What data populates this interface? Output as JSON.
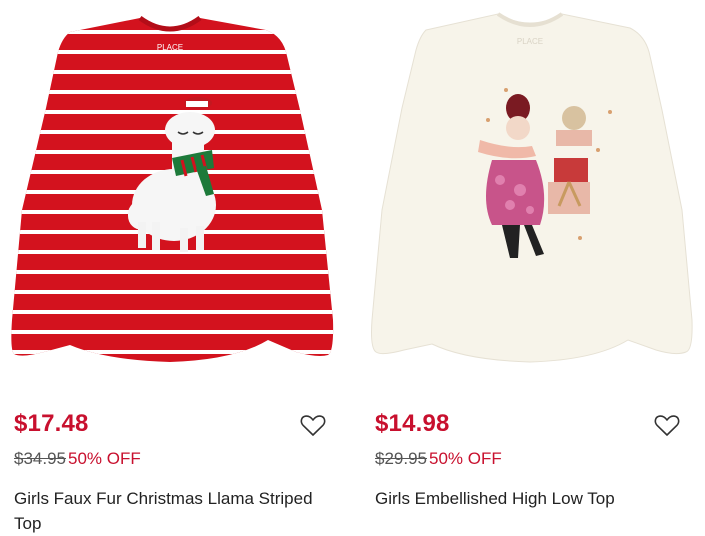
{
  "products": [
    {
      "image_label": "PLACE",
      "price": "$17.48",
      "original_price": "$34.95",
      "discount": "50% OFF",
      "title": "Girls Faux Fur Christmas Llama Striped Top",
      "colors": {
        "shirt": "#d3121e",
        "stripe": "#ffffff"
      }
    },
    {
      "image_label": "PLACE",
      "price": "$14.98",
      "original_price": "$29.95",
      "discount": "50% OFF",
      "title": "Girls Embellished High Low Top",
      "colors": {
        "shirt": "#f7f4ea"
      }
    }
  ],
  "colors": {
    "accent": "#c8102e",
    "text": "#222222",
    "muted": "#555555"
  },
  "icons": {
    "wishlist": "heart-outline-icon"
  }
}
